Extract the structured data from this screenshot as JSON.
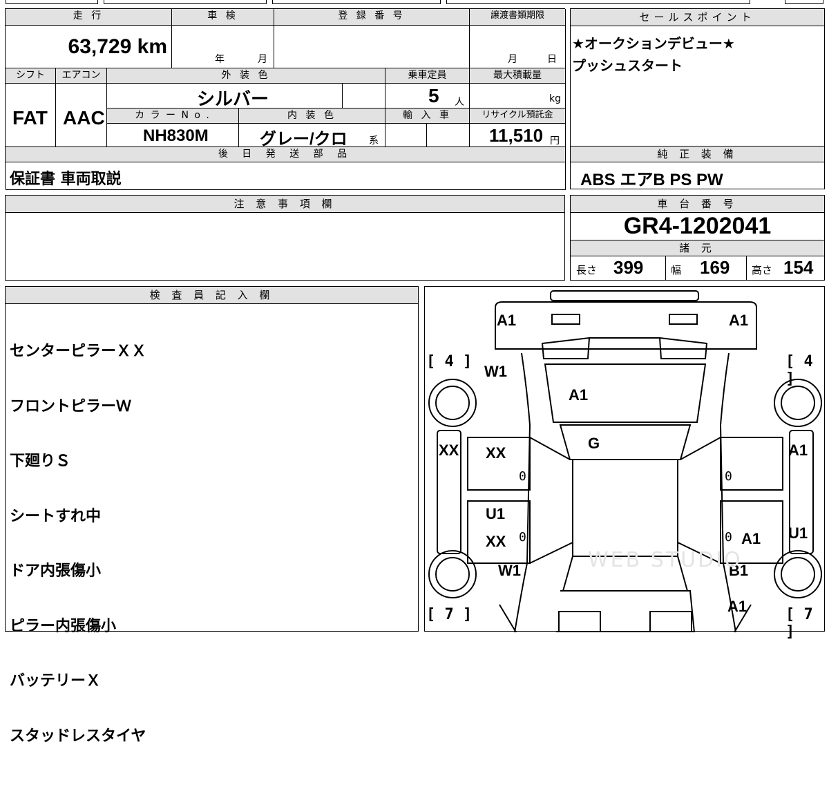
{
  "left_table": {
    "mileage_header": "走 行",
    "mileage": "63,729 km",
    "inspection_header": "車 検",
    "inspection_year": "年",
    "inspection_month": "月",
    "registration_header": "登 録 番 号",
    "transfer_deadline_header": "譲渡書類期限",
    "transfer_month": "月",
    "transfer_day": "日",
    "shift_header": "シフト",
    "shift": "FAT",
    "ac_header": "エアコン",
    "ac": "AAC",
    "exterior_color_header": "外 装 色",
    "exterior_color": "シルバー",
    "capacity_header": "乗車定員",
    "capacity_value": "5",
    "capacity_unit": "人",
    "max_load_header": "最大積載量",
    "max_load_unit": "kg",
    "color_no_header": "カ ラ ー N o .",
    "color_no": "NH830M",
    "interior_color_header": "内 装 色",
    "interior_color": "グレー/クロ",
    "interior_suffix": "系",
    "import_header": "輸 入 車",
    "recycle_header": "リサイクル預託金",
    "recycle_value": "11,510",
    "recycle_unit": "円",
    "later_parts_header": "後 日 発 送 部 品",
    "later_parts": "保証書 車両取説"
  },
  "sales_point": {
    "header": "セールスポイント",
    "line1": "★オークションデビュー★",
    "line2": "プッシュスタート"
  },
  "genuine_equipment": {
    "header": "純 正 装 備",
    "value": "ABS エアB PS PW"
  },
  "caution": {
    "header": "注 意 事 項 欄"
  },
  "chassis": {
    "header": "車 台 番 号",
    "value": "GR4-1202041",
    "spec_header": "諸 元",
    "length_label": "長さ",
    "length": "399",
    "width_label": "幅",
    "width": "169",
    "height_label": "高さ",
    "height": "154"
  },
  "inspector": {
    "header": "検 査 員 記 入 欄",
    "notes": [
      "センターピラーＸＸ",
      "フロントピラーＷ",
      "下廻りＳ",
      "シートすれ中",
      "ドア内張傷小",
      "ピラー内張傷小",
      "バッテリーＸ",
      "スタッドレスタイヤ"
    ]
  },
  "diagram": {
    "front_left_bumper": "A1",
    "front_right_bumper": "A1",
    "hood": "A1",
    "windshield": "G",
    "front_left_fender": "W1",
    "left_pillar": "XX",
    "front_left_door": "XX",
    "rear_left_door_top": "U1",
    "rear_left_door_bottom": "XX",
    "rear_left_fender": "W1",
    "right_front_fender": "A1",
    "right_rear_door": "A1",
    "right_quarter": "U1",
    "rear_right_fender": "B1",
    "rear_right_bumper": "A1",
    "tire_front_left": "4",
    "tire_front_right": "4",
    "tire_rear_left": "7",
    "tire_rear_right": "7",
    "zero_mark": "0",
    "watermark": "WEB STUDIO"
  }
}
